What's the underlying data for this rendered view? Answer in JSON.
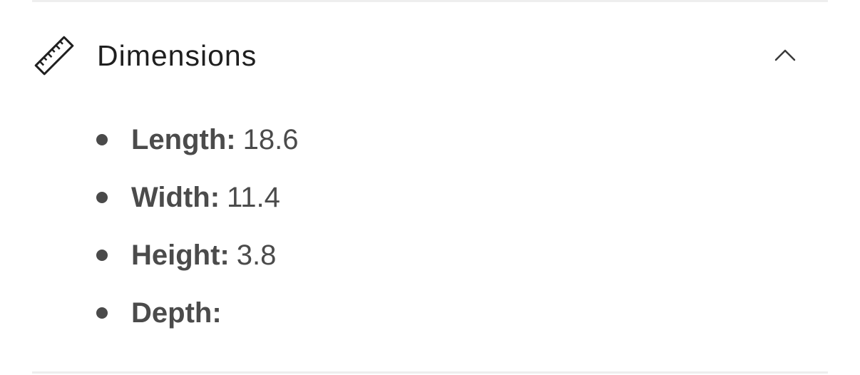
{
  "section": {
    "title": "Dimensions",
    "icon": "ruler-icon",
    "toggle_icon": "chevron-up-icon",
    "expanded": true
  },
  "dimensions": [
    {
      "label": "Length:",
      "value": "18.6"
    },
    {
      "label": "Width:",
      "value": "11.4"
    },
    {
      "label": "Height:",
      "value": "3.8"
    },
    {
      "label": "Depth:",
      "value": ""
    }
  ],
  "colors": {
    "text": "#4b4b4b",
    "title": "#1f1f1f",
    "divider": "#eeeeee"
  }
}
